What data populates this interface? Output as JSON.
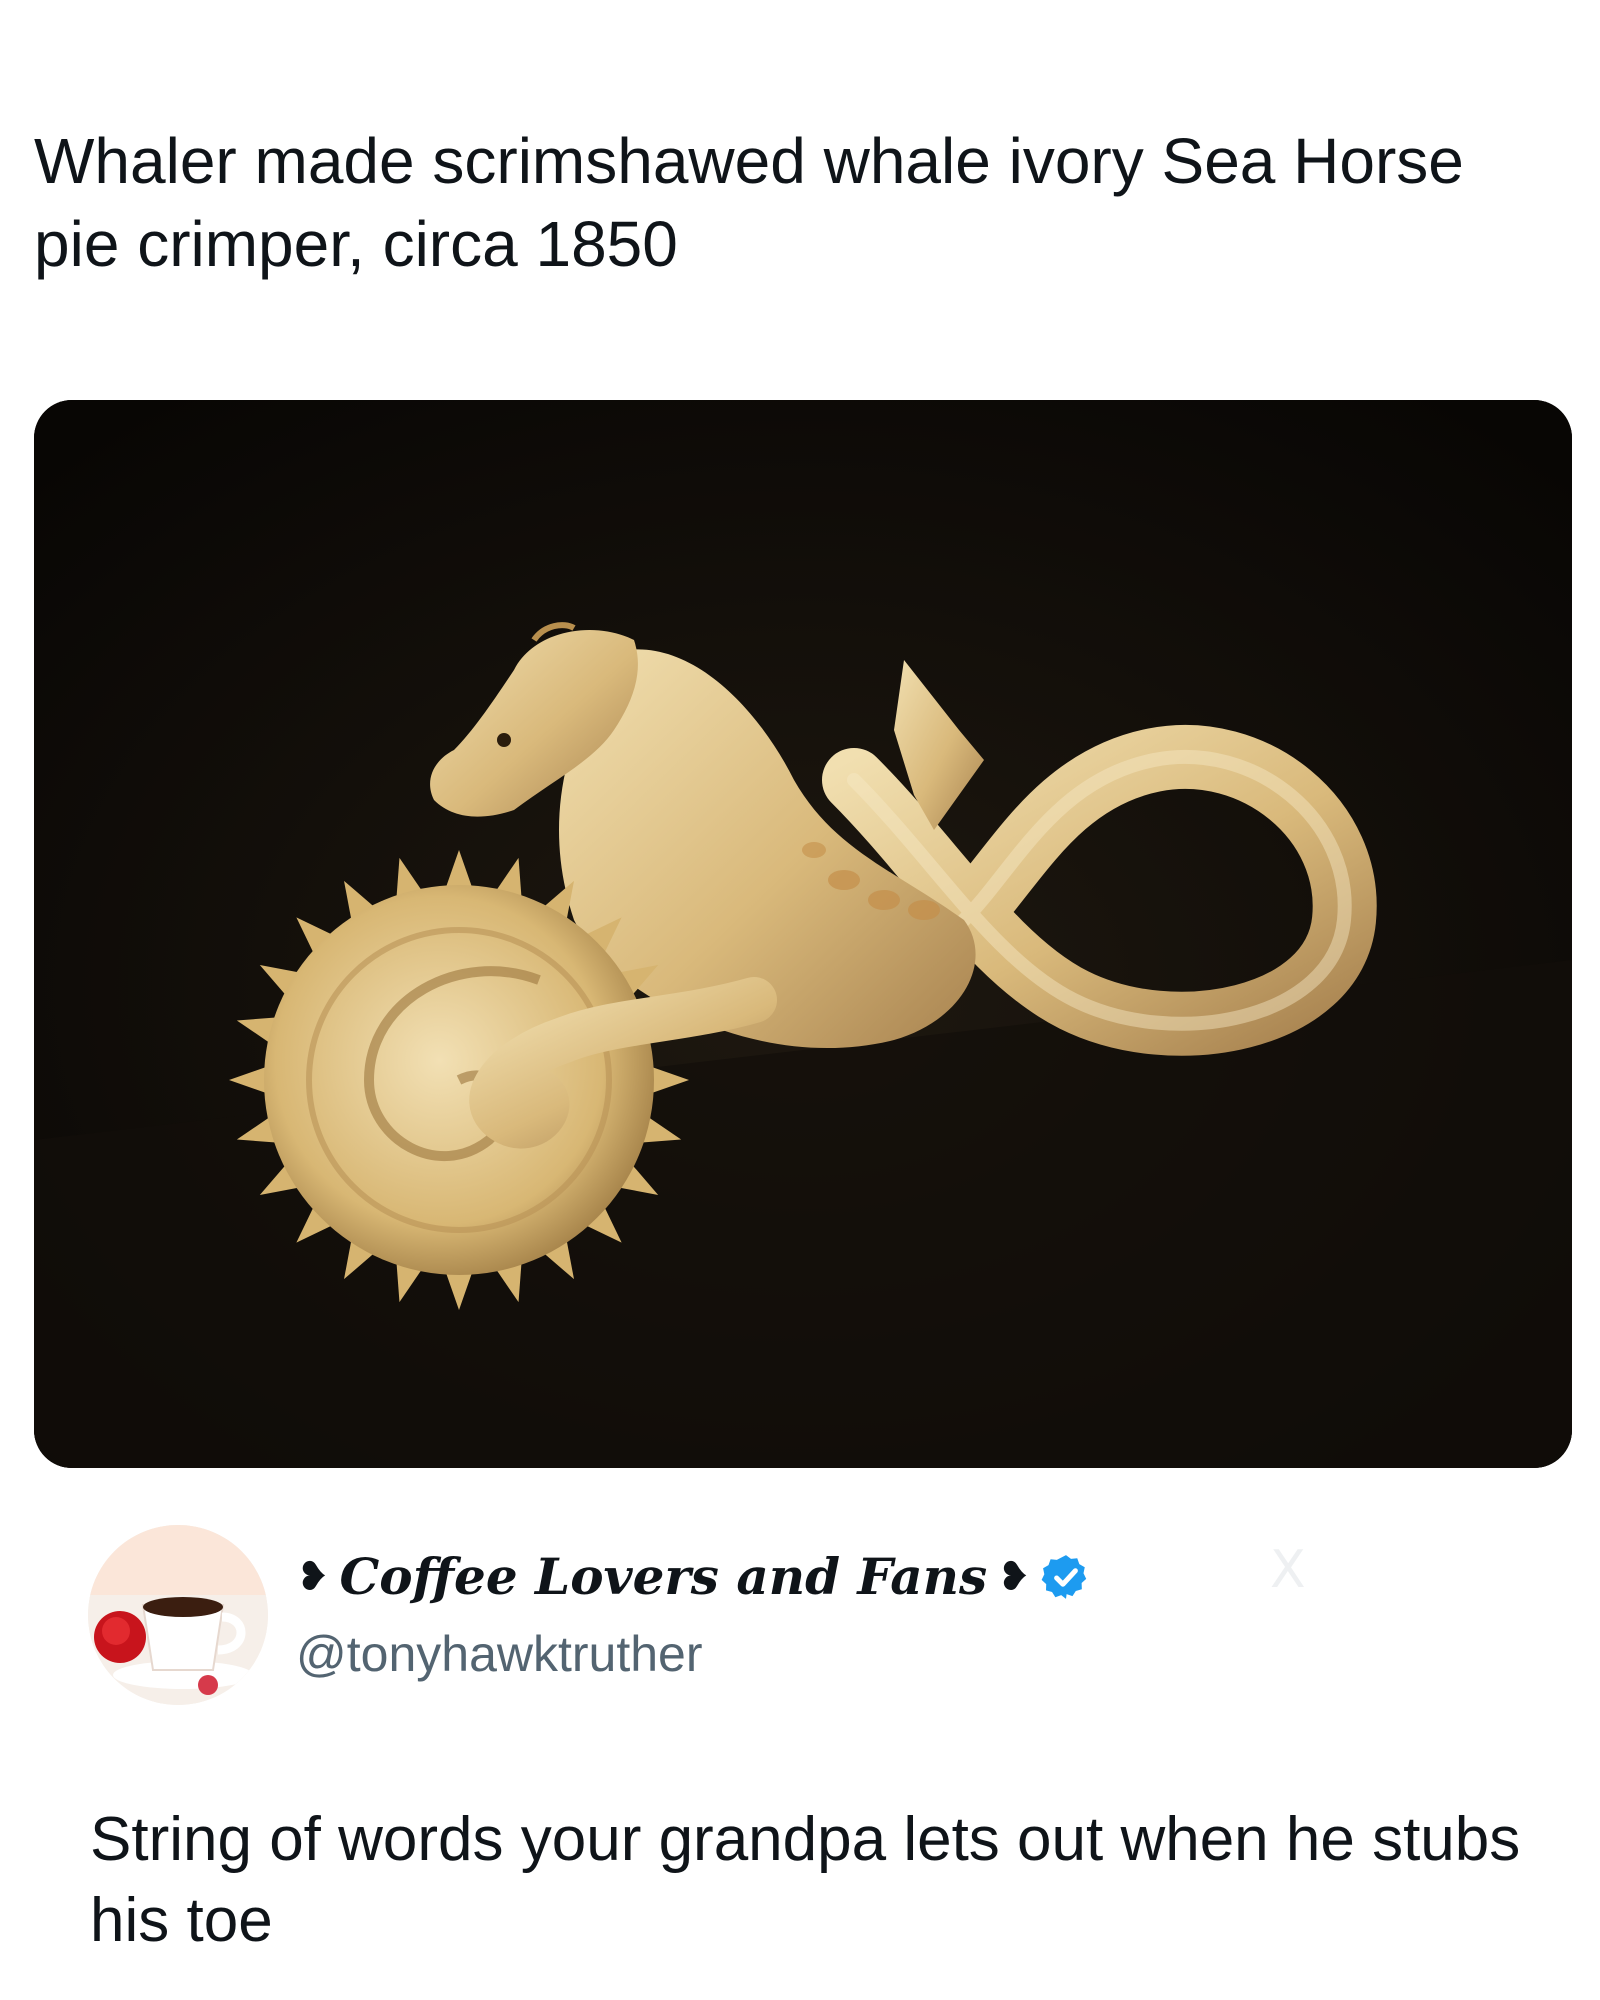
{
  "post": {
    "title": "Whaler made scrimshawed whale ivory Sea Horse pie crimper, circa 1850"
  },
  "media": {
    "icon": "photo-sea-horse-pie-crimper"
  },
  "author": {
    "ornament_left": "❥",
    "display_name": "Coffee Lovers and Fans",
    "ornament_right": "❥",
    "handle": "@tonyhawktruther",
    "verified_color": "#1d9bf0"
  },
  "watermark": {
    "label": "X"
  },
  "caption": {
    "text": "String of words your grandpa lets out when he stubs his toe"
  }
}
